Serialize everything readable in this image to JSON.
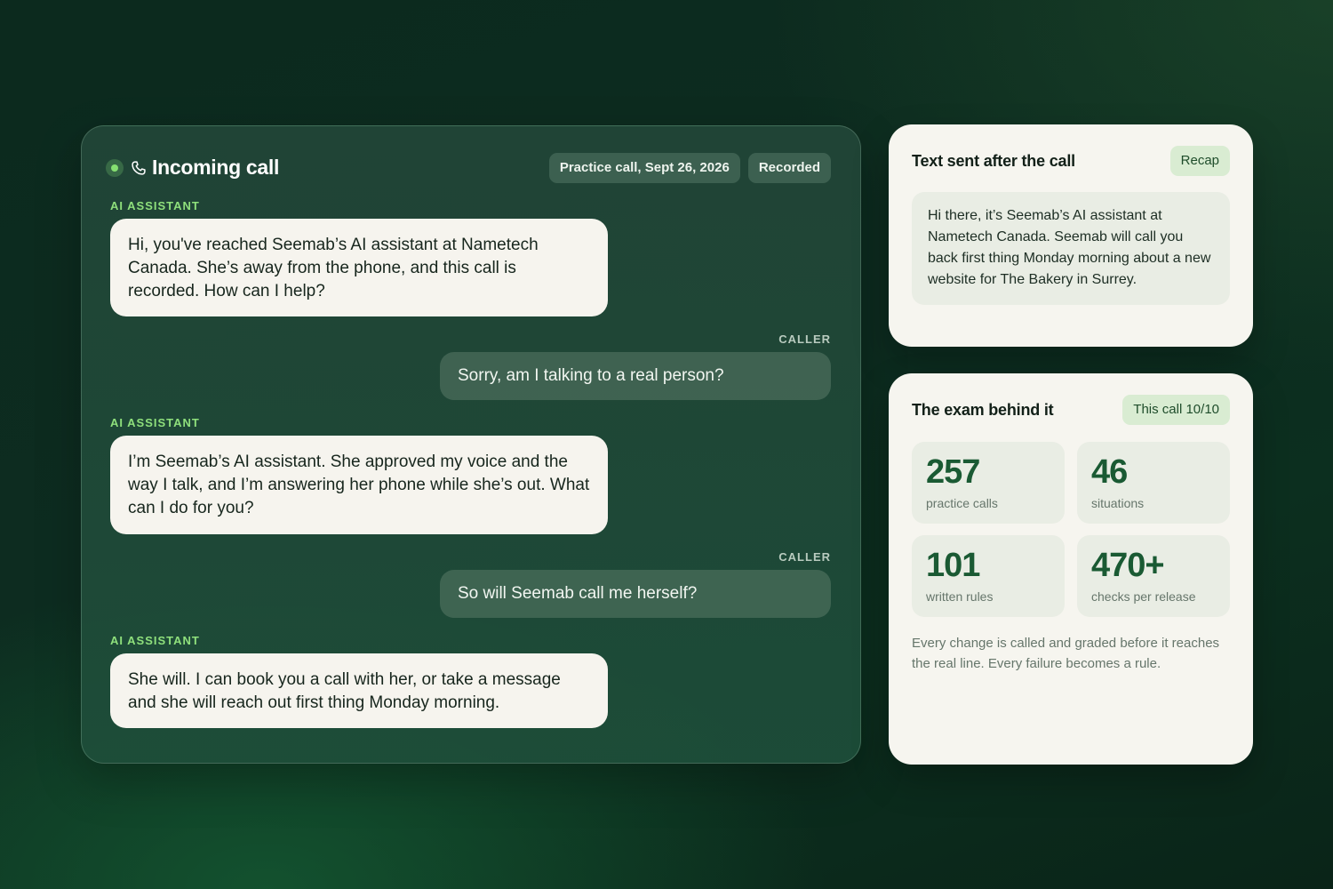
{
  "call": {
    "title": "Incoming call",
    "pills": [
      "Practice call, Sept 26, 2026",
      "Recorded"
    ],
    "messages": [
      {
        "speaker": "AI ASSISTANT",
        "text": "Hi, you've reached Seemab’s AI assistant at Nametech Canada. She’s away from the phone, and this call is recorded. How can I help?"
      },
      {
        "speaker": "CALLER",
        "text": "Sorry, am I talking to a real person?"
      },
      {
        "speaker": "AI ASSISTANT",
        "text": "I’m Seemab’s AI assistant. She approved my voice and the way I talk, and I’m answering her phone while she’s out. What can I do for you?"
      },
      {
        "speaker": "CALLER",
        "text": "So will Seemab call me herself?"
      },
      {
        "speaker": "AI ASSISTANT",
        "text": "She will. I can book you a call with her, or take a message and she will reach out first thing Monday morning."
      }
    ]
  },
  "recap": {
    "title": "Text sent after the call",
    "tag": "Recap",
    "message": "Hi there, it’s Seemab’s AI assistant at Nametech Canada. Seemab will call you back first thing Monday morning about a new website for The Bakery in Surrey."
  },
  "exam": {
    "title": "The exam behind it",
    "tag": "This call 10/10",
    "stats": [
      {
        "value": "257",
        "label": "practice calls"
      },
      {
        "value": "46",
        "label": "situations"
      },
      {
        "value": "101",
        "label": "written rules"
      },
      {
        "value": "470+",
        "label": "checks per release"
      }
    ],
    "footnote": "Every change is called and graded before it reaches the real line. Every failure becomes a rule."
  },
  "colors": {
    "accent_green": "#8fe07c",
    "stat_value": "#1a5a33",
    "card_background": "#f6f5ef"
  },
  "icons": [
    "live-indicator",
    "phone-icon"
  ]
}
